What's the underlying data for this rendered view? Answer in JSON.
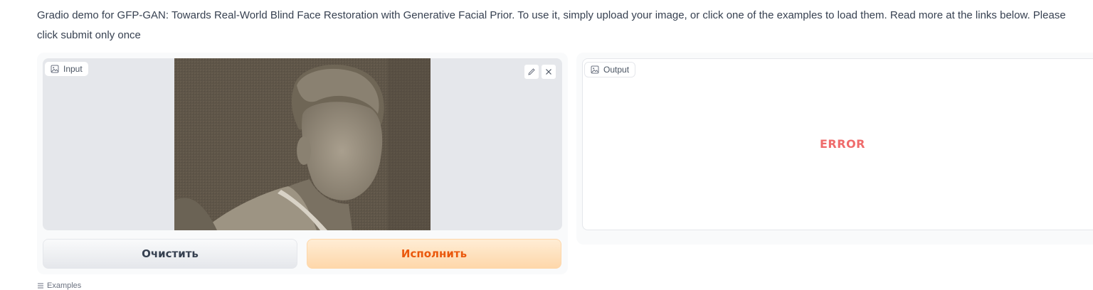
{
  "description": "Gradio demo for GFP-GAN: Towards Real-World Blind Face Restoration with Generative Facial Prior. To use it, simply upload your image, or click one of the examples to load them. Read more at the links below. Please click submit only once",
  "input": {
    "label": "Input",
    "label_icon": "image-icon",
    "tools": [
      "edit-icon",
      "close-icon"
    ]
  },
  "output": {
    "label": "Output",
    "label_icon": "image-icon",
    "status": "ERROR"
  },
  "buttons": {
    "clear_label": "Очистить",
    "submit_label": "Исполнить"
  },
  "examples": {
    "label": "Examples",
    "icon": "list-icon"
  },
  "colors": {
    "error": "#ef6b6b",
    "submit_text": "#ea580c",
    "submit_bg": "#fed7aa"
  }
}
